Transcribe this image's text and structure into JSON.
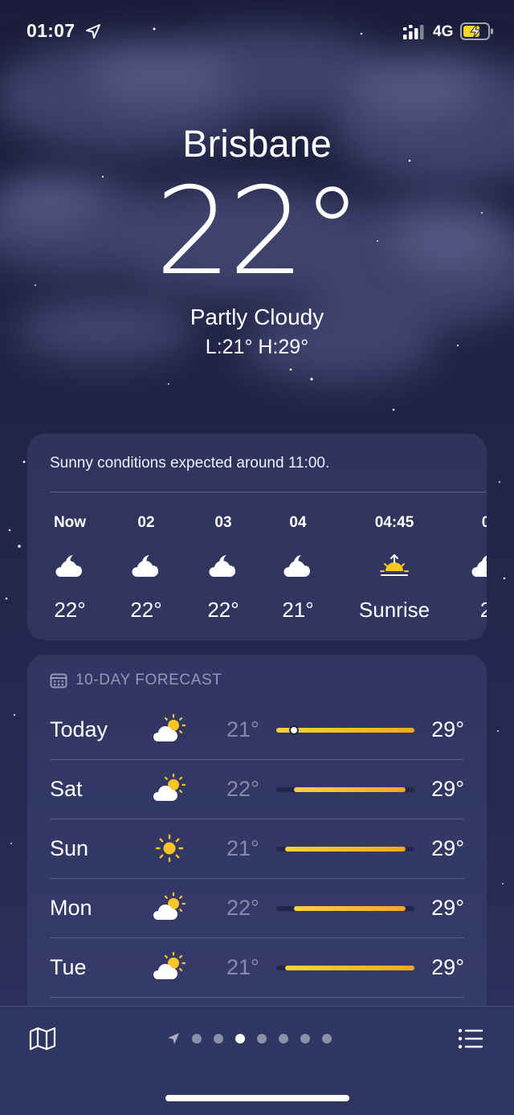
{
  "status": {
    "time": "01:07",
    "network": "4G"
  },
  "hero": {
    "city": "Brisbane",
    "temperature": "22°",
    "condition": "Partly Cloudy",
    "low_high": "L:21° H:29°"
  },
  "hourly": {
    "summary": "Sunny conditions expected around 11:00.",
    "items": [
      {
        "label": "Now",
        "icon": "partly-cloudy-night-icon",
        "value": "22°"
      },
      {
        "label": "02",
        "icon": "partly-cloudy-night-icon",
        "value": "22°"
      },
      {
        "label": "03",
        "icon": "partly-cloudy-night-icon",
        "value": "22°"
      },
      {
        "label": "04",
        "icon": "partly-cloudy-night-icon",
        "value": "21°"
      },
      {
        "label": "04:45",
        "icon": "sunrise-icon",
        "value": "Sunrise"
      },
      {
        "label": "0",
        "icon": "partly-cloudy-night-icon",
        "value": "2"
      }
    ]
  },
  "forecast": {
    "header": "10-DAY FORECAST",
    "range_scale": [
      21,
      29
    ],
    "days": [
      {
        "day": "Today",
        "icon": "partly-sunny-icon",
        "low": "21°",
        "high": "29°",
        "low_value": 21,
        "high_value": 29,
        "current_value": 22
      },
      {
        "day": "Sat",
        "icon": "partly-sunny-icon",
        "low": "22°",
        "high": "29°",
        "low_value": 22,
        "high_value": 28.5
      },
      {
        "day": "Sun",
        "icon": "sun-icon",
        "low": "21°",
        "high": "29°",
        "low_value": 21.5,
        "high_value": 28.5
      },
      {
        "day": "Mon",
        "icon": "partly-sunny-icon",
        "low": "22°",
        "high": "29°",
        "low_value": 22,
        "high_value": 28.5
      },
      {
        "day": "Tue",
        "icon": "partly-sunny-icon",
        "low": "21°",
        "high": "29°",
        "low_value": 21.5,
        "high_value": 29
      }
    ]
  },
  "pager": {
    "page_count": 7,
    "active_index": 2
  },
  "colors": {
    "accent_gradient_start": "#f8d33a",
    "accent_gradient_end": "#f5a623",
    "sun": "#f9c623"
  }
}
